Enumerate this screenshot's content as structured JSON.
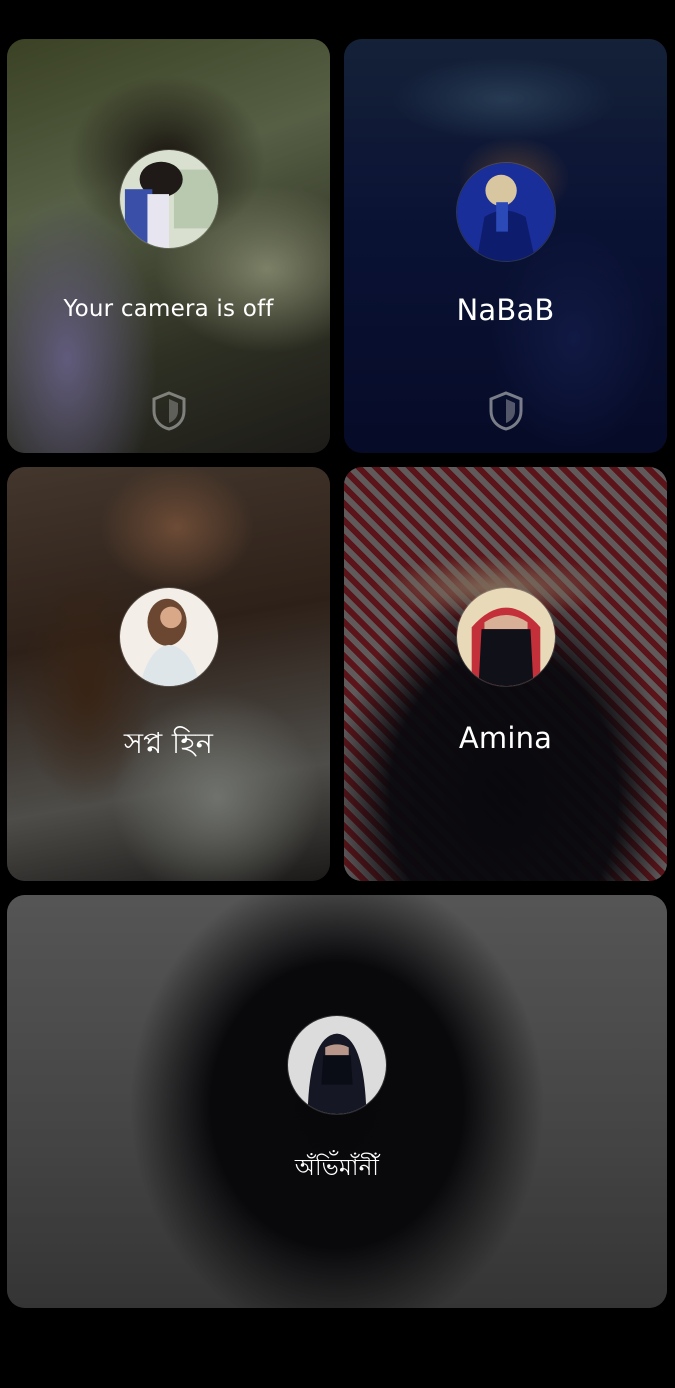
{
  "participants": [
    {
      "name": "Your camera is off",
      "shield_icon": "shield-icon"
    },
    {
      "name": "NaBaB",
      "shield_icon": "shield-icon"
    },
    {
      "name": "সপ্ন হিন"
    },
    {
      "name": "Amina"
    },
    {
      "name": "অঁভিঁমাঁনীঁ"
    }
  ],
  "colors": {
    "background": "#000000",
    "text": "#ffffff"
  }
}
